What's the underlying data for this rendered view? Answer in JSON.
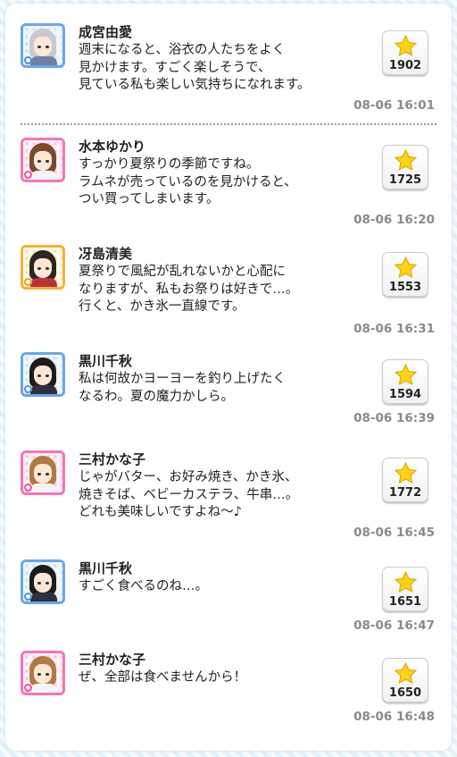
{
  "messages": [
    {
      "name": "成宮由愛",
      "text": "週末になると、浴衣の人たちをよく\n見かけます。すごく楽しそうで、\n見ている私も楽しい気持ちになれます。",
      "likes": "1902",
      "time": "08-06 16:01",
      "attribute": "cool",
      "hair": "#c9c9cf",
      "avatar_icon": "character-avatar-icon"
    },
    {
      "name": "水本ゆかり",
      "text": "すっかり夏祭りの季節ですね。\nラムネが売っているのを見かけると、\nつい買ってしまいます。",
      "likes": "1725",
      "time": "08-06 16:20",
      "attribute": "cute",
      "hair": "#7a4a2c",
      "avatar_icon": "character-avatar-icon"
    },
    {
      "name": "冴島清美",
      "text": "夏祭りで風紀が乱れないかと心配に\nなりますが、私もお祭りは好きで…。\n行くと、かき氷一直線です。",
      "likes": "1553",
      "time": "08-06 16:31",
      "attribute": "passion",
      "hair": "#2b2622",
      "avatar_icon": "character-avatar-icon"
    },
    {
      "name": "黒川千秋",
      "text": "私は何故かヨーヨーを釣り上げたく\nなるわ。夏の魔力かしら。",
      "likes": "1594",
      "time": "08-06 16:39",
      "attribute": "cool",
      "hair": "#1e1a1c",
      "avatar_icon": "character-avatar-icon"
    },
    {
      "name": "三村かな子",
      "text": "じゃがバター、お好み焼き、かき氷、\n焼きそば、ベビーカステラ、牛串…。\nどれも美味しいですよね～♪",
      "likes": "1772",
      "time": "08-06 16:45",
      "attribute": "cute",
      "hair": "#b07a45",
      "avatar_icon": "character-avatar-icon"
    },
    {
      "name": "黒川千秋",
      "text": "すごく食べるのね…。",
      "likes": "1651",
      "time": "08-06 16:47",
      "attribute": "cool",
      "hair": "#1e1a1c",
      "avatar_icon": "character-avatar-icon"
    },
    {
      "name": "三村かな子",
      "text": "ぜ、全部は食べませんから！",
      "likes": "1650",
      "time": "08-06 16:48",
      "attribute": "cute",
      "hair": "#b07a45",
      "avatar_icon": "character-avatar-icon"
    }
  ],
  "colors": {
    "star": "#ffd21a",
    "star_outline": "#e0a800",
    "timestamp": "#8a8a8a"
  },
  "like_icon": "star-icon"
}
